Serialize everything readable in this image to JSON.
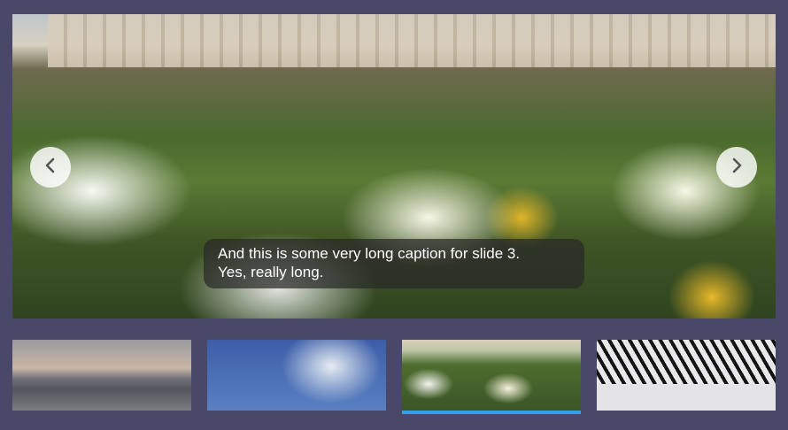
{
  "slider": {
    "caption_line1": "And this is some very long caption for slide 3.",
    "caption_line2": "Yes, really long.",
    "prev_icon": "chevron-left-icon",
    "next_icon": "chevron-right-icon",
    "active_index": 2,
    "accent_color": "#2ea3e3"
  },
  "thumbnails": [
    {
      "name": "thumb-harbor-sunset"
    },
    {
      "name": "thumb-tree-sky"
    },
    {
      "name": "thumb-garden-flowers"
    },
    {
      "name": "thumb-spiral-binding"
    }
  ]
}
